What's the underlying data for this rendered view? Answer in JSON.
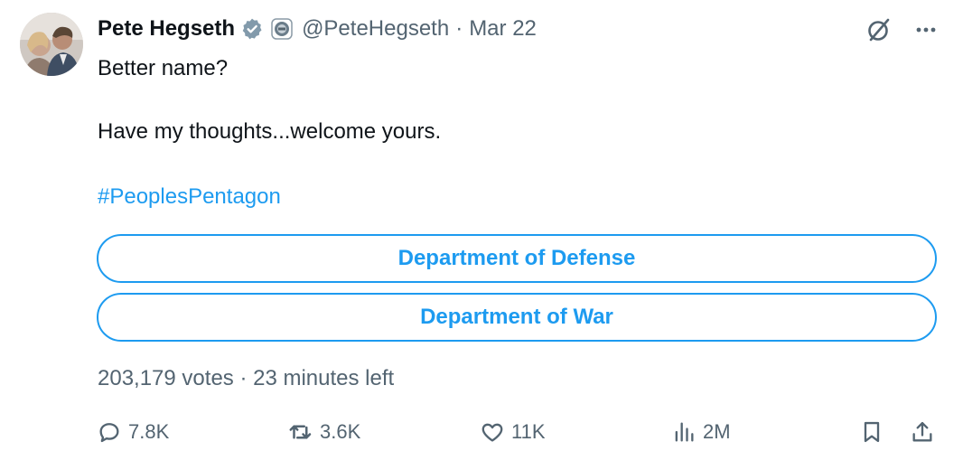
{
  "author": {
    "name": "Pete Hegseth",
    "handle": "@PeteHegseth",
    "separator": "·",
    "date": "Mar 22"
  },
  "tweet": {
    "line1": "Better name?",
    "line2": "Have my thoughts...welcome yours.",
    "hashtag": "#PeoplesPentagon"
  },
  "poll": {
    "options": [
      {
        "label": "Department of Defense"
      },
      {
        "label": "Department of War"
      }
    ],
    "meta": "203,179 votes · 23 minutes left"
  },
  "actions": {
    "replies": "7.8K",
    "reposts": "3.6K",
    "likes": "11K",
    "views": "2M"
  },
  "colors": {
    "accent": "#1d9bf0",
    "secondary_text": "#536471",
    "primary_text": "#0f1419",
    "verified_badge": "#829aab"
  },
  "icons": {
    "verified": "verified-badge-icon",
    "government": "government-affiliation-icon",
    "grok": "grok-icon",
    "more": "more-icon",
    "reply": "reply-icon",
    "repost": "repost-icon",
    "like": "heart-icon",
    "views": "views-icon",
    "bookmark": "bookmark-icon",
    "share": "share-icon"
  }
}
